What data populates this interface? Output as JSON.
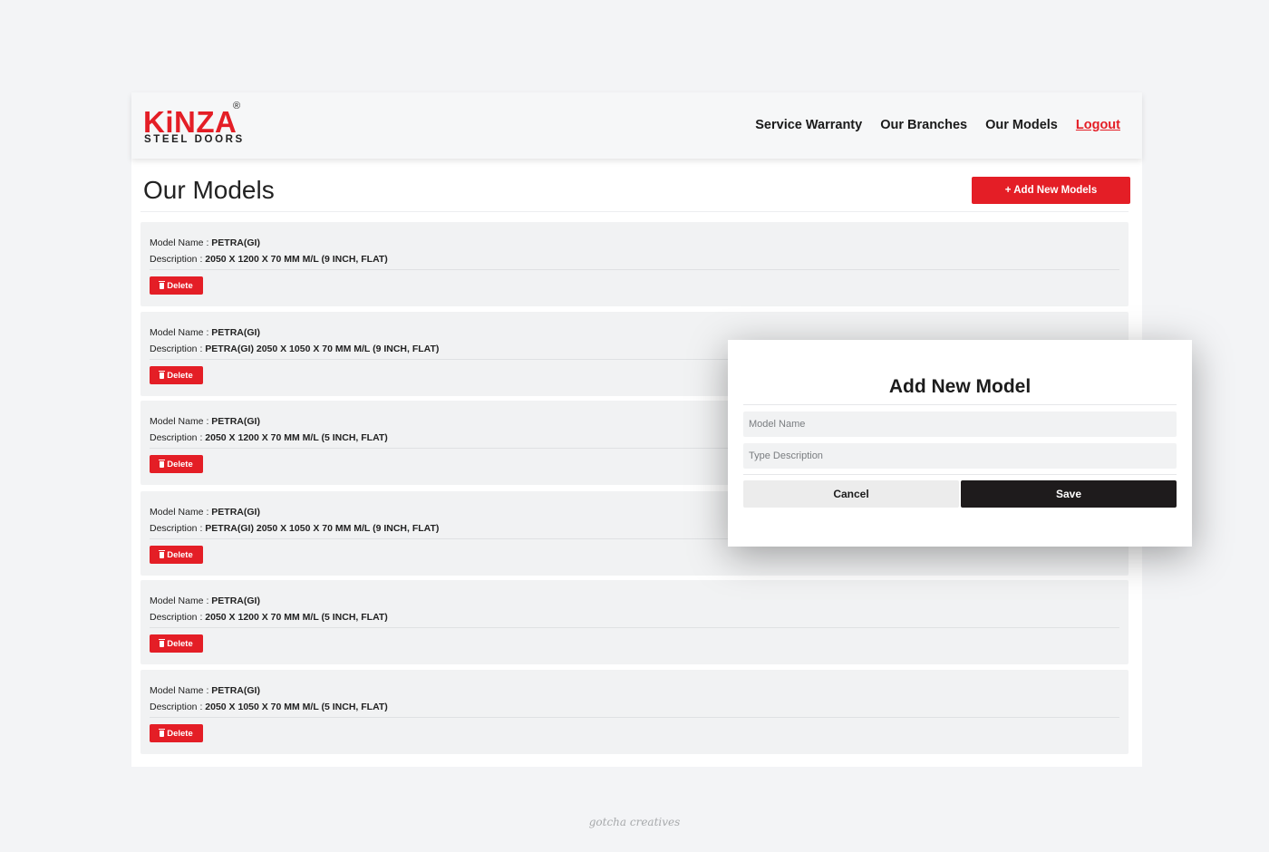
{
  "brand": {
    "name": "KiNZA",
    "registered_mark": "®",
    "tagline": "STEEL DOORS",
    "primary_color": "#e41e26",
    "dark_color": "#1e1b1c"
  },
  "nav": {
    "items": [
      {
        "label": "Service Warranty"
      },
      {
        "label": "Our Branches"
      },
      {
        "label": "Our Models"
      },
      {
        "label": "Logout"
      }
    ]
  },
  "page": {
    "title": "Our Models",
    "add_button_label": "+ Add New Models"
  },
  "labels": {
    "model_name": "Model Name :",
    "description": "Description :",
    "delete": "Delete"
  },
  "models": [
    {
      "name": "PETRA(GI)",
      "description": "2050 X 1200 X 70 MM M/L (9 INCH, FLAT)"
    },
    {
      "name": "PETRA(GI)",
      "description": "PETRA(GI) 2050 X 1050 X 70 MM M/L (9 INCH, FLAT)"
    },
    {
      "name": "PETRA(GI)",
      "description": "2050 X 1200 X 70 MM M/L (5 INCH, FLAT)"
    },
    {
      "name": "PETRA(GI)",
      "description": "PETRA(GI) 2050 X 1050 X 70 MM M/L (9 INCH, FLAT)"
    },
    {
      "name": "PETRA(GI)",
      "description": "2050 X 1200 X 70 MM M/L (5 INCH, FLAT)"
    },
    {
      "name": "PETRA(GI)",
      "description": "2050 X 1050 X 70 MM M/L (5 INCH, FLAT)"
    }
  ],
  "modal": {
    "title": "Add New Model",
    "model_name_placeholder": "Model Name",
    "description_placeholder": "Type Description",
    "cancel_label": "Cancel",
    "save_label": "Save"
  },
  "watermark": "gotcha creatives"
}
